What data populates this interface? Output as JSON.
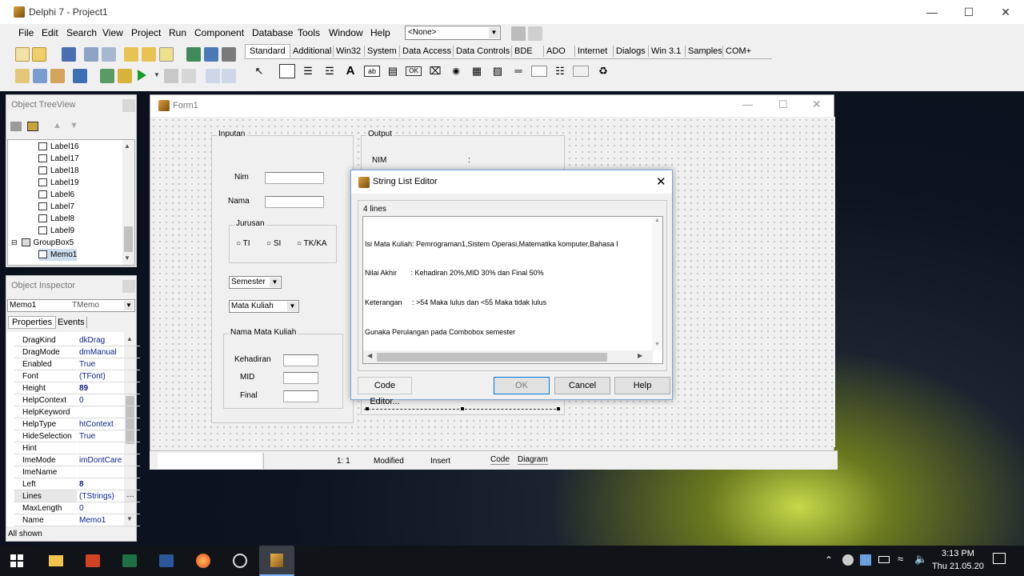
{
  "app": {
    "title": "Delphi 7 - Project1",
    "none_combo": "<None>"
  },
  "menu": [
    "File",
    "Edit",
    "Search",
    "View",
    "Project",
    "Run",
    "Component",
    "Database",
    "Tools",
    "Window",
    "Help"
  ],
  "palette_tabs": [
    "Standard",
    "Additional",
    "Win32",
    "System",
    "Data Access",
    "Data Controls",
    "BDE",
    "ADO",
    "Internet",
    "Dialogs",
    "Win 3.1",
    "Samples",
    "COM+"
  ],
  "treeview": {
    "title": "Object TreeView",
    "items": [
      "Label16",
      "Label17",
      "Label18",
      "Label19",
      "Label6",
      "Label7",
      "Label8",
      "Label9",
      "GroupBox5",
      "Memo1"
    ]
  },
  "inspector": {
    "title": "Object Inspector",
    "object": "Memo1",
    "type": "TMemo",
    "tabs": [
      "Properties",
      "Events"
    ],
    "rows": [
      [
        "DragKind",
        "dkDrag"
      ],
      [
        "DragMode",
        "dmManual"
      ],
      [
        "Enabled",
        "True"
      ],
      [
        "Font",
        "(TFont)"
      ],
      [
        "Height",
        "89"
      ],
      [
        "HelpContext",
        "0"
      ],
      [
        "HelpKeyword",
        ""
      ],
      [
        "HelpType",
        "htContext"
      ],
      [
        "HideSelection",
        "True"
      ],
      [
        "Hint",
        ""
      ],
      [
        "ImeMode",
        "imDontCare"
      ],
      [
        "ImeName",
        ""
      ],
      [
        "Left",
        "8"
      ],
      [
        "Lines",
        "(TStrings)"
      ],
      [
        "MaxLength",
        "0"
      ],
      [
        "Name",
        "Memo1"
      ]
    ],
    "status": "All shown"
  },
  "form": {
    "title": "Form1",
    "inputan": "Inputan",
    "output": "Output",
    "nim_out": "NIM",
    "colon": ":",
    "nim": "Nim",
    "nama": "Nama",
    "jurusan": "Jurusan",
    "radios": [
      "TI",
      "SI",
      "TK/KA"
    ],
    "semester": "Semester",
    "mata_kuliah": "Mata Kuliah",
    "nama_mk": "Nama Mata Kuliah",
    "kehadiran": "Kehadiran",
    "mid": "MID",
    "final": "Final"
  },
  "dialog": {
    "title": "String List Editor",
    "count": "4 lines",
    "lines": [
      "Isi Mata Kuliah: Pemrograman1,Sistem Operasi,Matematika komputer,Bahasa I",
      "Nilai Akhir       : Kehadiran 20%,MID 30% dan Final 50%",
      "Keterangan     : >54 Maka lulus dan <55 Maka tidak lulus",
      "Gunaka Perulangan pada Combobox semester"
    ],
    "code_editor": "Code Editor...",
    "ok": "OK",
    "cancel": "Cancel",
    "help": "Help"
  },
  "statusbar": {
    "pos": "1:   1",
    "modified": "Modified",
    "insert": "Insert",
    "code": "Code",
    "diagram": "Diagram"
  },
  "clock": {
    "time": "3:13 PM",
    "date": "Thu 21.05.20"
  }
}
